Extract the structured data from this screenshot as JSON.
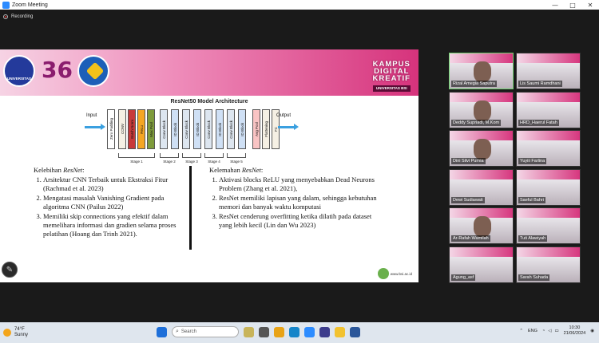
{
  "window": {
    "title": "Zoom Meeting",
    "controls": [
      "—",
      "□",
      "✕"
    ]
  },
  "recording": {
    "label": "Recording"
  },
  "slide": {
    "banner": {
      "logo1_text": "UNIVERSITAS",
      "logo2_text": "36",
      "brand_line1": "KAMPUS",
      "brand_line2": "DIGITAL",
      "brand_line3": "KREATIF",
      "brand_sub": "UNIVERSITAS BSI"
    },
    "diagram_title": "ResNet50 Model Architecture",
    "input_label": "Input",
    "output_label": "Output",
    "blocks": [
      "Zero Padding",
      "CONV",
      "Batch Norm",
      "ReLu",
      "Max Pool",
      "Conv Block",
      "ID Block",
      "Conv Block",
      "ID Block",
      "Conv Block",
      "ID Block",
      "Conv Block",
      "ID Block",
      "Avg Pool",
      "Flattening",
      "FC"
    ],
    "stages": [
      "Stage 1",
      "Stage 2",
      "Stage 3",
      "Stage 4",
      "Stage 5"
    ],
    "left_heading": "Kelebihan ",
    "left_heading_em": "ResNet",
    "left_heading_end": ":",
    "left_items": [
      "Arsitektur CNN Terbaik untuk Ekstraksi Fitur (Rachmad et al. 2023)",
      "Mengatasi masalah Vanishing Gradient pada algoritma CNN (Pailus 2022)",
      "Memiliki skip connections yang efektif dalam memelihara informasi dan gradien selama proses pelatihan (Hoang dan Trinh 2021)."
    ],
    "right_heading": "Kelemahan ",
    "right_heading_em": "ResNet",
    "right_heading_end": ":",
    "right_items": [
      "Aktivasi blocks ReLU yang menyebabkan Dead Neurons Problem (Zhang et al. 2021),",
      "ResNet memiliki lapisan yang dalam, sehingga kebutuhan memori dan banyak waktu komputasi",
      "ResNet cenderung overfitting ketika dilatih pada dataset yang lebih kecil (Lin dan Wu 2023)"
    ],
    "footer_logo": "www.bsi.ac.id"
  },
  "participants": [
    "Rizal Amegia Saputra",
    "Lis Saumi Ramdhani",
    "Deddy Supriadi, M.Kom",
    "HRD_Haerul Fatah",
    "Dini Silvi Purnia",
    "Yuyiii Farlina",
    "Dewi Sudiawati",
    "Saeful Bahri",
    "Ar-Rafah Wamilah",
    "Tuti Alawiyah",
    "Agung_asf",
    "Sarah Suhada"
  ],
  "taskbar": {
    "temp": "74°F",
    "weather": "Sunny",
    "search_placeholder": "Search",
    "lang": "ENG",
    "time": "10:30",
    "date": "21/06/2024"
  }
}
